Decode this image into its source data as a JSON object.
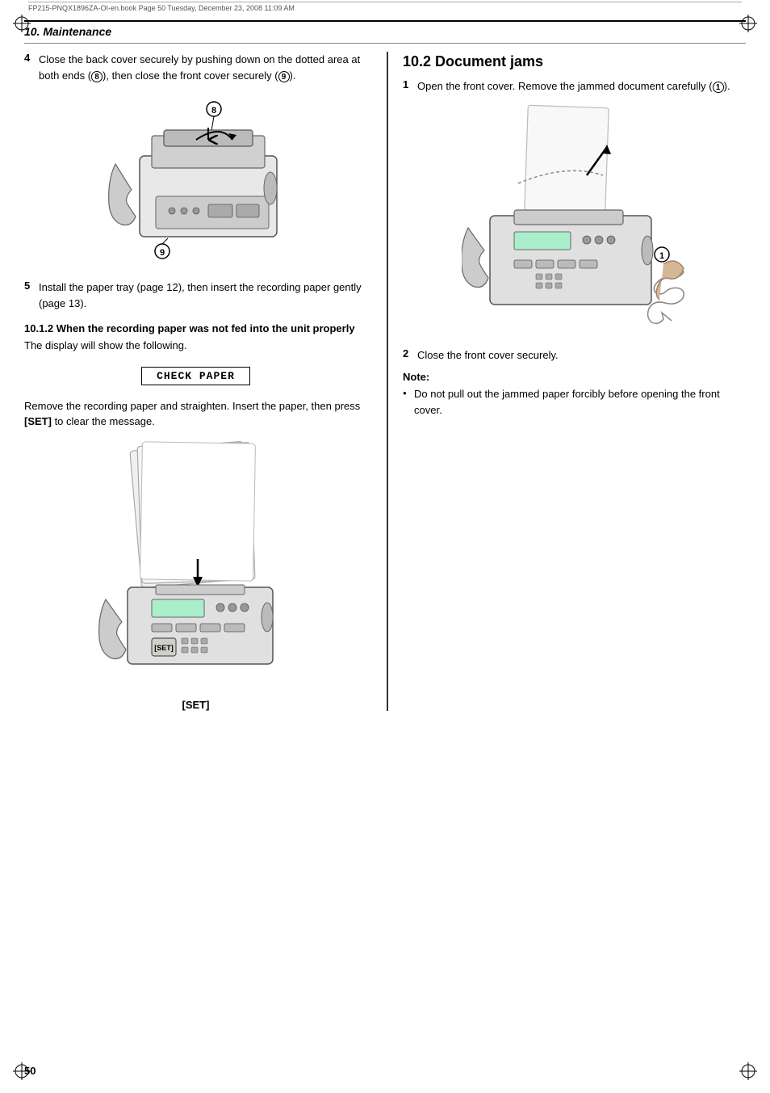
{
  "page": {
    "meta_line": "FP215-PNQX1896ZA-OI-en.book  Page 50  Tuesday, December 23, 2008  11:09 AM",
    "chapter_title": "10. Maintenance",
    "page_number": "50"
  },
  "left_col": {
    "step4_num": "4",
    "step4_text": "Close the back cover securely by pushing down on the dotted area at both ends (",
    "step4_circle8": "8",
    "step4_text2": "), then close the front cover securely (",
    "step4_circle9": "9",
    "step4_text3": ").",
    "step5_num": "5",
    "step5_text": "Install the paper tray (page 12), then insert the recording paper gently (page 13).",
    "sub_section_title": "10.1.2 When the recording paper was not fed into the unit properly",
    "sub_section_intro": "The display will show the following.",
    "check_paper_label": "CHECK PAPER",
    "remove_text": "Remove the recording paper and straighten. Insert the paper, then press ",
    "set_key": "[SET]",
    "remove_text2": " to clear the message.",
    "set_caption": "[SET]"
  },
  "right_col": {
    "section_title": "10.2 Document jams",
    "step1_num": "1",
    "step1_text": "Open the front cover. Remove the jammed document carefully (",
    "step1_circle1": "1",
    "step1_text2": ").",
    "step2_num": "2",
    "step2_text": "Close the front cover securely.",
    "note_label": "Note:",
    "note_items": [
      "Do not pull out the jammed paper forcibly before opening the front cover."
    ]
  }
}
